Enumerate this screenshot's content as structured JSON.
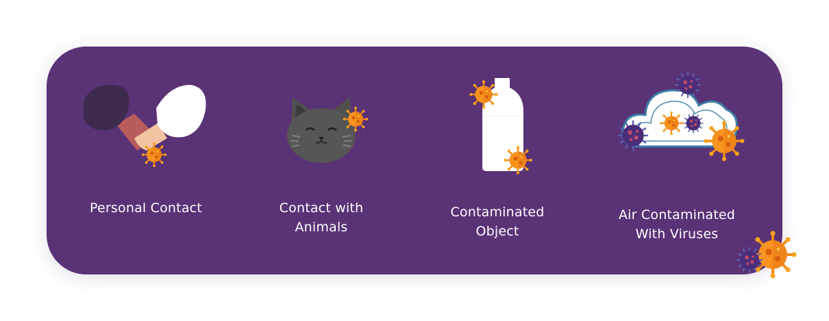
{
  "items": [
    {
      "icon": "handshake-virus-icon",
      "lines": [
        "Personal Contact"
      ]
    },
    {
      "icon": "cat-virus-icon",
      "lines": [
        "Contact with",
        "Animals"
      ]
    },
    {
      "icon": "bottle-virus-icon",
      "lines": [
        "Contaminated",
        "Object"
      ]
    },
    {
      "icon": "cloud-virus-icon",
      "lines": [
        "Air Contaminated",
        "With Viruses"
      ]
    }
  ],
  "colors": {
    "card": "#5a3276",
    "text": "#ffffff",
    "virus_orange": "#f7931e",
    "virus_purple": "#4a2e7a"
  }
}
